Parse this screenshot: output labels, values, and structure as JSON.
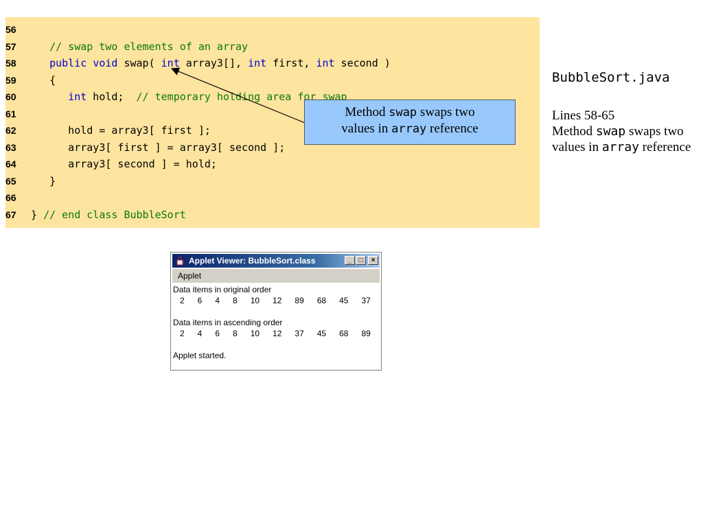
{
  "code": {
    "lines": [
      {
        "num": "56",
        "parts": []
      },
      {
        "num": "57",
        "parts": [
          {
            "t": "   ",
            "c": ""
          },
          {
            "t": "// swap two elements of an array",
            "c": "cm"
          }
        ]
      },
      {
        "num": "58",
        "parts": [
          {
            "t": "   ",
            "c": ""
          },
          {
            "t": "public",
            "c": "kw"
          },
          {
            "t": " ",
            "c": ""
          },
          {
            "t": "void",
            "c": "kw"
          },
          {
            "t": " swap( ",
            "c": ""
          },
          {
            "t": "int",
            "c": "kw"
          },
          {
            "t": " array3[], ",
            "c": ""
          },
          {
            "t": "int",
            "c": "kw"
          },
          {
            "t": " first, ",
            "c": ""
          },
          {
            "t": "int",
            "c": "kw"
          },
          {
            "t": " second )",
            "c": ""
          }
        ]
      },
      {
        "num": "59",
        "parts": [
          {
            "t": "   {",
            "c": ""
          }
        ]
      },
      {
        "num": "60",
        "parts": [
          {
            "t": "      ",
            "c": ""
          },
          {
            "t": "int",
            "c": "kw"
          },
          {
            "t": " hold;  ",
            "c": ""
          },
          {
            "t": "// temporary holding area for swap",
            "c": "cm"
          }
        ]
      },
      {
        "num": "61",
        "parts": []
      },
      {
        "num": "62",
        "parts": [
          {
            "t": "      hold = array3[ first ];",
            "c": ""
          }
        ]
      },
      {
        "num": "63",
        "parts": [
          {
            "t": "      array3[ first ] = array3[ second ];",
            "c": ""
          }
        ]
      },
      {
        "num": "64",
        "parts": [
          {
            "t": "      array3[ second ] = hold;",
            "c": ""
          }
        ]
      },
      {
        "num": "65",
        "parts": [
          {
            "t": "   }",
            "c": ""
          }
        ]
      },
      {
        "num": "66",
        "parts": []
      },
      {
        "num": "67",
        "parts": [
          {
            "t": "} ",
            "c": ""
          },
          {
            "t": "// end class BubbleSort",
            "c": "cm"
          }
        ]
      }
    ]
  },
  "callout": {
    "text1": "Method ",
    "code1": "swap",
    "text2": " swaps two",
    "text3": "values in ",
    "code2": "array",
    "text4": " reference"
  },
  "sidebar": {
    "file_name": "BubbleSort.java",
    "lines_label": "Lines 58-65",
    "desc1": "Method ",
    "code1": "swap",
    "desc2": " swaps two values in ",
    "code2": "array",
    "desc3": " reference"
  },
  "applet": {
    "title": "Applet Viewer: BubbleSort.class",
    "minimize": "_",
    "maximize": "□",
    "close": "×",
    "menu": "Applet",
    "original_label": "Data items in original order",
    "original_values": "2   6   4   8   10   12   89   68   45   37",
    "ascending_label": "Data items in ascending order",
    "ascending_values": "2   4   6   8   10   12   37   45   68   89",
    "status": "Applet started."
  },
  "colors": {
    "code_bg": "#fde49f",
    "keyword": "#0000cc",
    "comment": "#0a7a0a",
    "callout_bg": "#98c8fc"
  }
}
